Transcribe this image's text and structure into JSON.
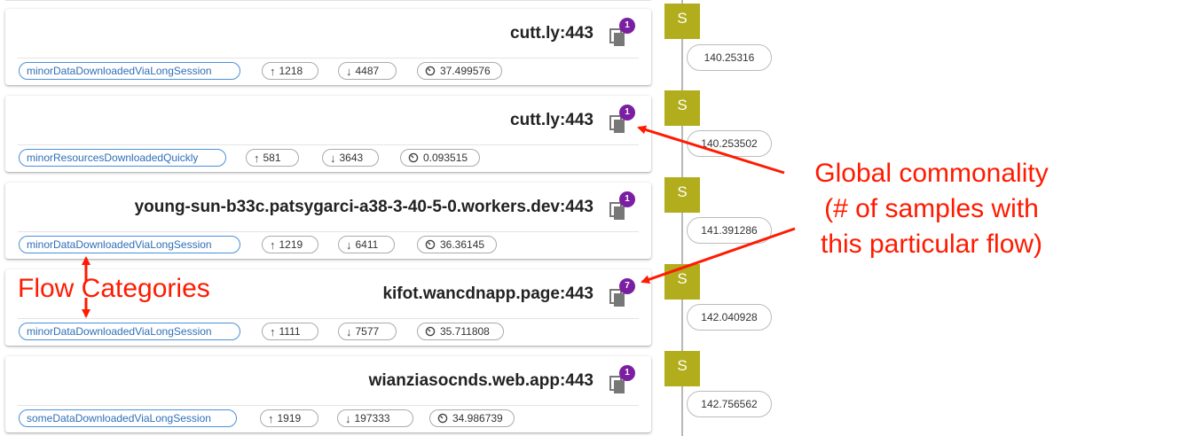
{
  "flows": [
    {
      "host": "cutt.ly:443",
      "badge": "1",
      "category": "minorDataDownloadedViaLongSession",
      "up": "1218",
      "down": "4487",
      "duration": "37.499576",
      "timestamp": "140.25316"
    },
    {
      "host": "cutt.ly:443",
      "badge": "1",
      "category": "minorResourcesDownloadedQuickly",
      "up": "581",
      "down": "3643",
      "duration": "0.093515",
      "timestamp": "140.253502"
    },
    {
      "host": "young-sun-b33c.patsygarci-a38-3-40-5-0.workers.dev:443",
      "badge": "1",
      "category": "minorDataDownloadedViaLongSession",
      "up": "1219",
      "down": "6411",
      "duration": "36.36145",
      "timestamp": "141.391286"
    },
    {
      "host": "kifot.wancdnapp.page:443",
      "badge": "7",
      "category": "minorDataDownloadedViaLongSession",
      "up": "1111",
      "down": "7577",
      "duration": "35.711808",
      "timestamp": "142.040928"
    },
    {
      "host": "wianziasocnds.web.app:443",
      "badge": "1",
      "category": "someDataDownloadedViaLongSession",
      "up": "1919",
      "down": "197333",
      "duration": "34.986739",
      "timestamp": "142.756562"
    }
  ],
  "marker_label": "S",
  "annotations": {
    "commonality_line1": "Global commonality",
    "commonality_line2": "(# of samples with",
    "commonality_line3": "this particular flow)",
    "categories": "Flow Categories"
  },
  "colors": {
    "badge": "#7b1fa2",
    "marker": "#b2ad1c",
    "annotation": "#ff1a00",
    "category_chip": "#4a90d9"
  },
  "icons": {
    "copy": "copy-icon",
    "up": "arrow-up-icon",
    "down": "arrow-down-icon",
    "duration": "timer-icon"
  }
}
